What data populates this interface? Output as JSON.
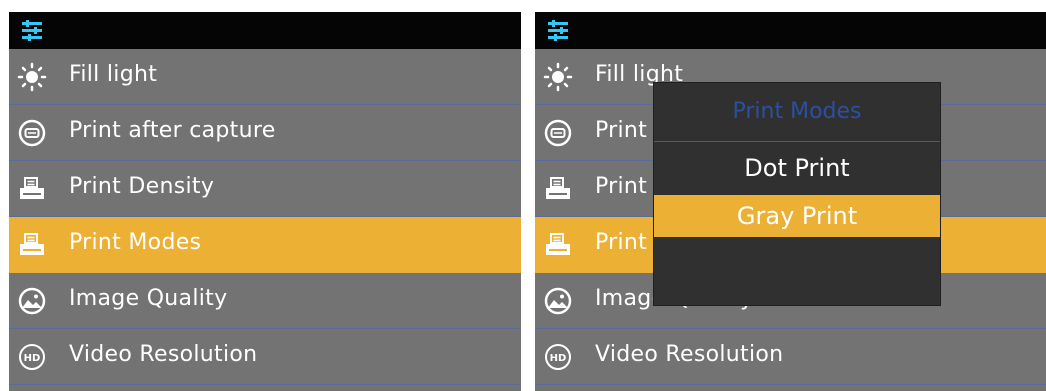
{
  "colors": {
    "screen_bg": "#737373",
    "topbar_bg": "#050505",
    "accent": "#ecb035",
    "separator": "#5a6a9a",
    "popup_bg": "#303030",
    "popup_title": "#2b50a0",
    "text": "#ffffff",
    "topbar_icon": "#36c6f4"
  },
  "left": {
    "topbar_icon": "settings-sliders-icon",
    "menu": [
      {
        "label": "Fill light",
        "icon": "sun-icon"
      },
      {
        "label": "Print after capture",
        "icon": "print-circle-icon"
      },
      {
        "label": "Print Density",
        "icon": "printer-icon"
      },
      {
        "label": "Print Modes",
        "icon": "printer-icon",
        "selected": true
      },
      {
        "label": "Image Quality",
        "icon": "image-circle-icon"
      },
      {
        "label": "Video Resolution",
        "icon": "hd-icon"
      }
    ]
  },
  "right": {
    "topbar_icon": "settings-sliders-icon",
    "menu": [
      {
        "label": "Fill light",
        "icon": "sun-icon"
      },
      {
        "label": "Print after capture",
        "icon": "print-circle-icon"
      },
      {
        "label": "Print Density",
        "icon": "printer-icon"
      },
      {
        "label": "Print Modes",
        "icon": "printer-icon",
        "selected": true
      },
      {
        "label": "Image Quality",
        "icon": "image-circle-icon"
      },
      {
        "label": "Video Resolution",
        "icon": "hd-icon"
      }
    ],
    "popup": {
      "title": "Print Modes",
      "options": [
        {
          "label": "Dot Print",
          "selected": false
        },
        {
          "label": "Gray Print",
          "selected": true
        }
      ]
    }
  }
}
